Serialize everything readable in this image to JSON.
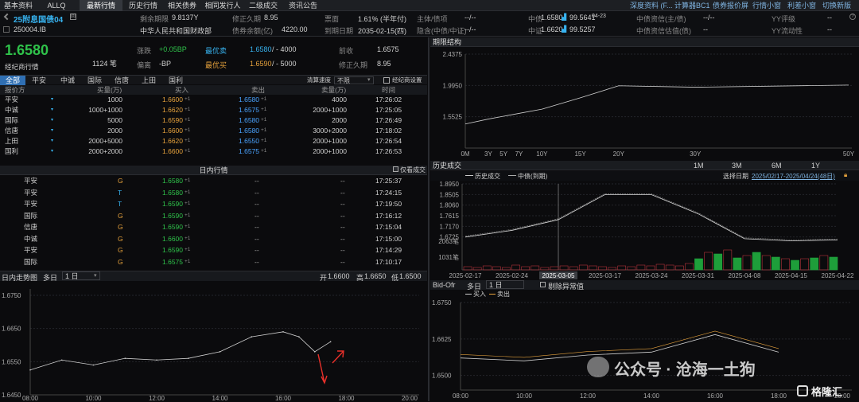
{
  "nav": {
    "tabs": [
      "基本资料",
      "ALLQ",
      "最新行情",
      "历史行情",
      "相关债券",
      "相同发行人",
      "二级成交",
      "资讯公告"
    ],
    "active": 2,
    "right_links": [
      "深度资料 (F...",
      "计算器BC1",
      "债券报价屏",
      "行情小窗",
      "利差小窗",
      "切换新版F5"
    ]
  },
  "bond": {
    "name": "25附息国债04",
    "code": "250004.IB",
    "badge": "回",
    "issuer": "中华人民共和国财政部",
    "remaining_term_label": "剩余期限",
    "remaining_term": "9.8137Y",
    "mod_duration_label": "修正久期",
    "mod_duration": "8.95",
    "balance_label": "债券余额(亿)",
    "balance": "4220.00",
    "coupon_label": "票面",
    "coupon": "1.61% (半年付)",
    "maturity_label": "到期日期",
    "maturity": "2035-02-15(四)",
    "rating_main_label": "主体/债项",
    "rating_main": "--/--",
    "rating_guarantee_label": "隐含(中债/中证)",
    "rating_guarantee": "--/--",
    "cb_label": "中债",
    "cb_yield": "1.6580",
    "cb_price": "99.5641",
    "cb_date": "04-23",
    "cs_label": "中证",
    "cs_yield": "1.6620",
    "cs_price": "99.5257",
    "cs_date": "05-15",
    "cb_credit_main_label": "中债资信(主/债)",
    "cb_credit_main": "--/--",
    "cb_credit_val_label": "中债资信估值(债)",
    "cb_credit_val": "--",
    "yy_rating_label": "YY评级",
    "yy_rating": "--",
    "yy_liq_label": "YY流动性",
    "yy_liq": "--"
  },
  "quote": {
    "price": "1.6580",
    "source": "经纪商行情",
    "count": "1124 笔",
    "change_label": "涨跌",
    "change": "+0.05BP",
    "deviation_label": "偏离",
    "deviation": "-BP",
    "best_bid_label": "最优卖",
    "best_bid": "1.6580",
    "best_bid_vol": "/ - 4000",
    "best_ask_label": "最优买",
    "best_ask": "1.6590",
    "best_ask_vol": "/ - 5000",
    "prev_close_label": "前收",
    "prev_close": "1.6575",
    "mod_dur_label": "修正久期",
    "mod_dur": "8.95"
  },
  "broker_tabs": [
    "全部",
    "平安",
    "中诚",
    "国际",
    "信唐",
    "上田",
    "国利"
  ],
  "broker_tabs_active": 0,
  "clear_speed_label": "清算速度",
  "clear_speed": "不限",
  "broker_setting": "经纪商设置",
  "quote_table": {
    "headers": [
      "报价方",
      "买量(万)",
      "买入",
      "卖出",
      "卖量(万)",
      "时间"
    ],
    "rows": [
      [
        "平安",
        "1000",
        "1.6600",
        "1.6580",
        "4000",
        "17:26:02"
      ],
      [
        "中诚",
        "1000+1000",
        "1.6620",
        "1.6575",
        "2000+1000",
        "17:25:05"
      ],
      [
        "国际",
        "5000",
        "1.6590",
        "1.6580",
        "2000",
        "17:26:49"
      ],
      [
        "信唐",
        "2000",
        "1.6600",
        "1.6580",
        "3000+2000",
        "17:18:02"
      ],
      [
        "上田",
        "2000+5000",
        "1.6620",
        "1.6550",
        "2000+1000",
        "17:26:54"
      ],
      [
        "国利",
        "2000+2000",
        "1.6600",
        "1.6575",
        "2000+1000",
        "17:26:53"
      ]
    ]
  },
  "intraday": {
    "title": "日内行情",
    "only_deal": "仅看成交",
    "rows": [
      [
        "平安",
        "G",
        "1.6580",
        "--",
        "--",
        "17:25:37"
      ],
      [
        "平安",
        "T",
        "1.6580",
        "--",
        "--",
        "17:24:15"
      ],
      [
        "平安",
        "T",
        "1.6590",
        "--",
        "--",
        "17:19:50"
      ],
      [
        "国际",
        "G",
        "1.6590",
        "--",
        "--",
        "17:16:12"
      ],
      [
        "信唐",
        "G",
        "1.6590",
        "--",
        "--",
        "17:15:04"
      ],
      [
        "中诚",
        "G",
        "1.6600",
        "--",
        "--",
        "17:15:00"
      ],
      [
        "平安",
        "G",
        "1.6590",
        "--",
        "--",
        "17:14:29"
      ],
      [
        "国际",
        "G",
        "1.6575",
        "--",
        "--",
        "17:10:17"
      ]
    ]
  },
  "intraday_chart": {
    "title": "日内走势图",
    "period_label": "多日",
    "period": "1 日",
    "open_label": "开",
    "open": "1.6600",
    "high_label": "高",
    "high": "1.6650",
    "low_label": "低",
    "low": "1.6500",
    "y_ticks": [
      "1.6750",
      "1.6650",
      "1.6550",
      "1.6450"
    ],
    "x_ticks": [
      "08:00",
      "10:00",
      "12:00",
      "14:00",
      "16:00",
      "18:00",
      "20:00"
    ]
  },
  "term_structure": {
    "title": "期限结构",
    "y_ticks": [
      "2.4375",
      "1.9950",
      "1.5525"
    ],
    "x_ticks": [
      "0M",
      "3Y",
      "5Y",
      "7Y",
      "10Y",
      "15Y",
      "20Y",
      "30Y",
      "50Y"
    ]
  },
  "history": {
    "title": "历史成交",
    "ranges": [
      "1M",
      "3M",
      "6M",
      "1Y"
    ],
    "legend_deal": "历史成交",
    "legend_cb": "中债(到期)",
    "date_label": "选择日期",
    "date_range": "2025/02/17-2025/04/24(48日)",
    "y_ticks": [
      "1.8950",
      "1.8505",
      "1.8060",
      "1.7615",
      "1.7170",
      "1.6725",
      "2063笔",
      "1031笔"
    ],
    "x_ticks": [
      "2025-02-17",
      "2025-02-24",
      "2025-03-05",
      "2025-03-17",
      "2025-03-24",
      "2025-03-31",
      "2025-04-08",
      "2025-04-15",
      "2025-04-22"
    ]
  },
  "bidofr": {
    "title": "Bid-Ofr",
    "period_label": "多日",
    "period": "1 日",
    "remove_abnormal": "剔除异常值",
    "legend_bid": "买入",
    "legend_ofr": "卖出",
    "y_ticks": [
      "1.6750",
      "1.6625",
      "1.6500"
    ],
    "x_ticks": [
      "08:00",
      "10:00",
      "12:00",
      "14:00",
      "16:00",
      "18:00",
      "20:00"
    ]
  },
  "watermark": {
    "text": "公众号 · 沧海一土狗",
    "logo": "格隆汇"
  },
  "chart_data": [
    {
      "type": "line",
      "name": "日内走势图",
      "x": [
        "08:00",
        "09:00",
        "10:00",
        "11:00",
        "12:00",
        "13:00",
        "14:00",
        "15:00",
        "16:00",
        "16:30",
        "17:00",
        "17:30"
      ],
      "values": [
        1.6525,
        1.6555,
        1.654,
        1.656,
        1.6555,
        1.656,
        1.658,
        1.6625,
        1.664,
        1.6625,
        1.658,
        1.661
      ],
      "ylim": [
        1.645,
        1.675
      ]
    },
    {
      "type": "line",
      "name": "期限结构",
      "x": [
        "0M",
        "3Y",
        "5Y",
        "7Y",
        "10Y",
        "15Y",
        "20Y",
        "30Y",
        "50Y"
      ],
      "values": [
        1.45,
        1.52,
        1.56,
        1.6,
        1.66,
        1.82,
        1.99,
        1.97,
        2.0
      ],
      "ylim": [
        1.5525,
        2.4375
      ]
    },
    {
      "type": "line",
      "name": "历史成交",
      "x": [
        "02-17",
        "02-24",
        "03-05",
        "03-17",
        "03-24",
        "03-31",
        "04-08",
        "04-15",
        "04-22"
      ],
      "values": [
        1.672,
        1.7,
        1.745,
        1.85,
        1.85,
        1.77,
        1.665,
        1.656,
        1.66
      ],
      "ylim": [
        1.6725,
        1.895
      ]
    },
    {
      "type": "line",
      "name": "Bid-Ofr",
      "x": [
        "08:00",
        "10:00",
        "12:00",
        "14:00",
        "16:00",
        "18:00"
      ],
      "values": [
        1.656,
        1.655,
        1.657,
        1.658,
        1.664,
        1.658
      ],
      "ylim": [
        1.65,
        1.675
      ]
    }
  ]
}
